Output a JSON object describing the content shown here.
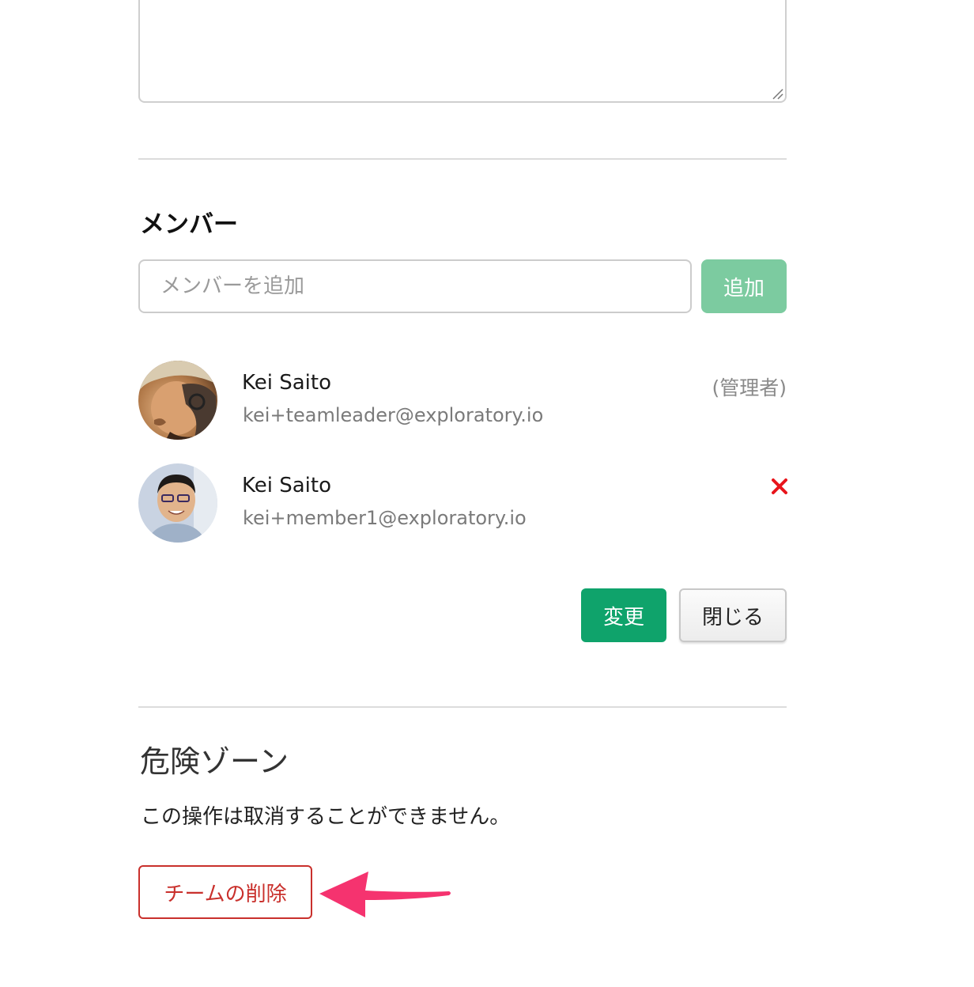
{
  "description_field": {
    "value": ""
  },
  "members_section": {
    "title": "メンバー",
    "add_input_placeholder": "メンバーを追加",
    "add_button_label": "追加",
    "members": [
      {
        "name": "Kei Saito",
        "email": "kei+teamleader@exploratory.io",
        "role": "(管理者)",
        "avatar_icon": "avatar-photo"
      },
      {
        "name": "Kei Saito",
        "email": "kei+member1@exploratory.io",
        "role": "",
        "avatar_icon": "avatar-photo",
        "remove_icon": "close-icon"
      }
    ]
  },
  "actions": {
    "save_label": "変更",
    "close_label": "閉じる"
  },
  "danger_zone": {
    "title": "危険ゾーン",
    "description": "この操作は取消することができません。",
    "delete_button_label": "チームの削除"
  },
  "colors": {
    "add_button_bg": "#7ccba0",
    "save_button_bg": "#0fa36b",
    "danger_red": "#c9302c",
    "remove_icon_red": "#e8141b",
    "annotation_arrow": "#f5336f"
  }
}
